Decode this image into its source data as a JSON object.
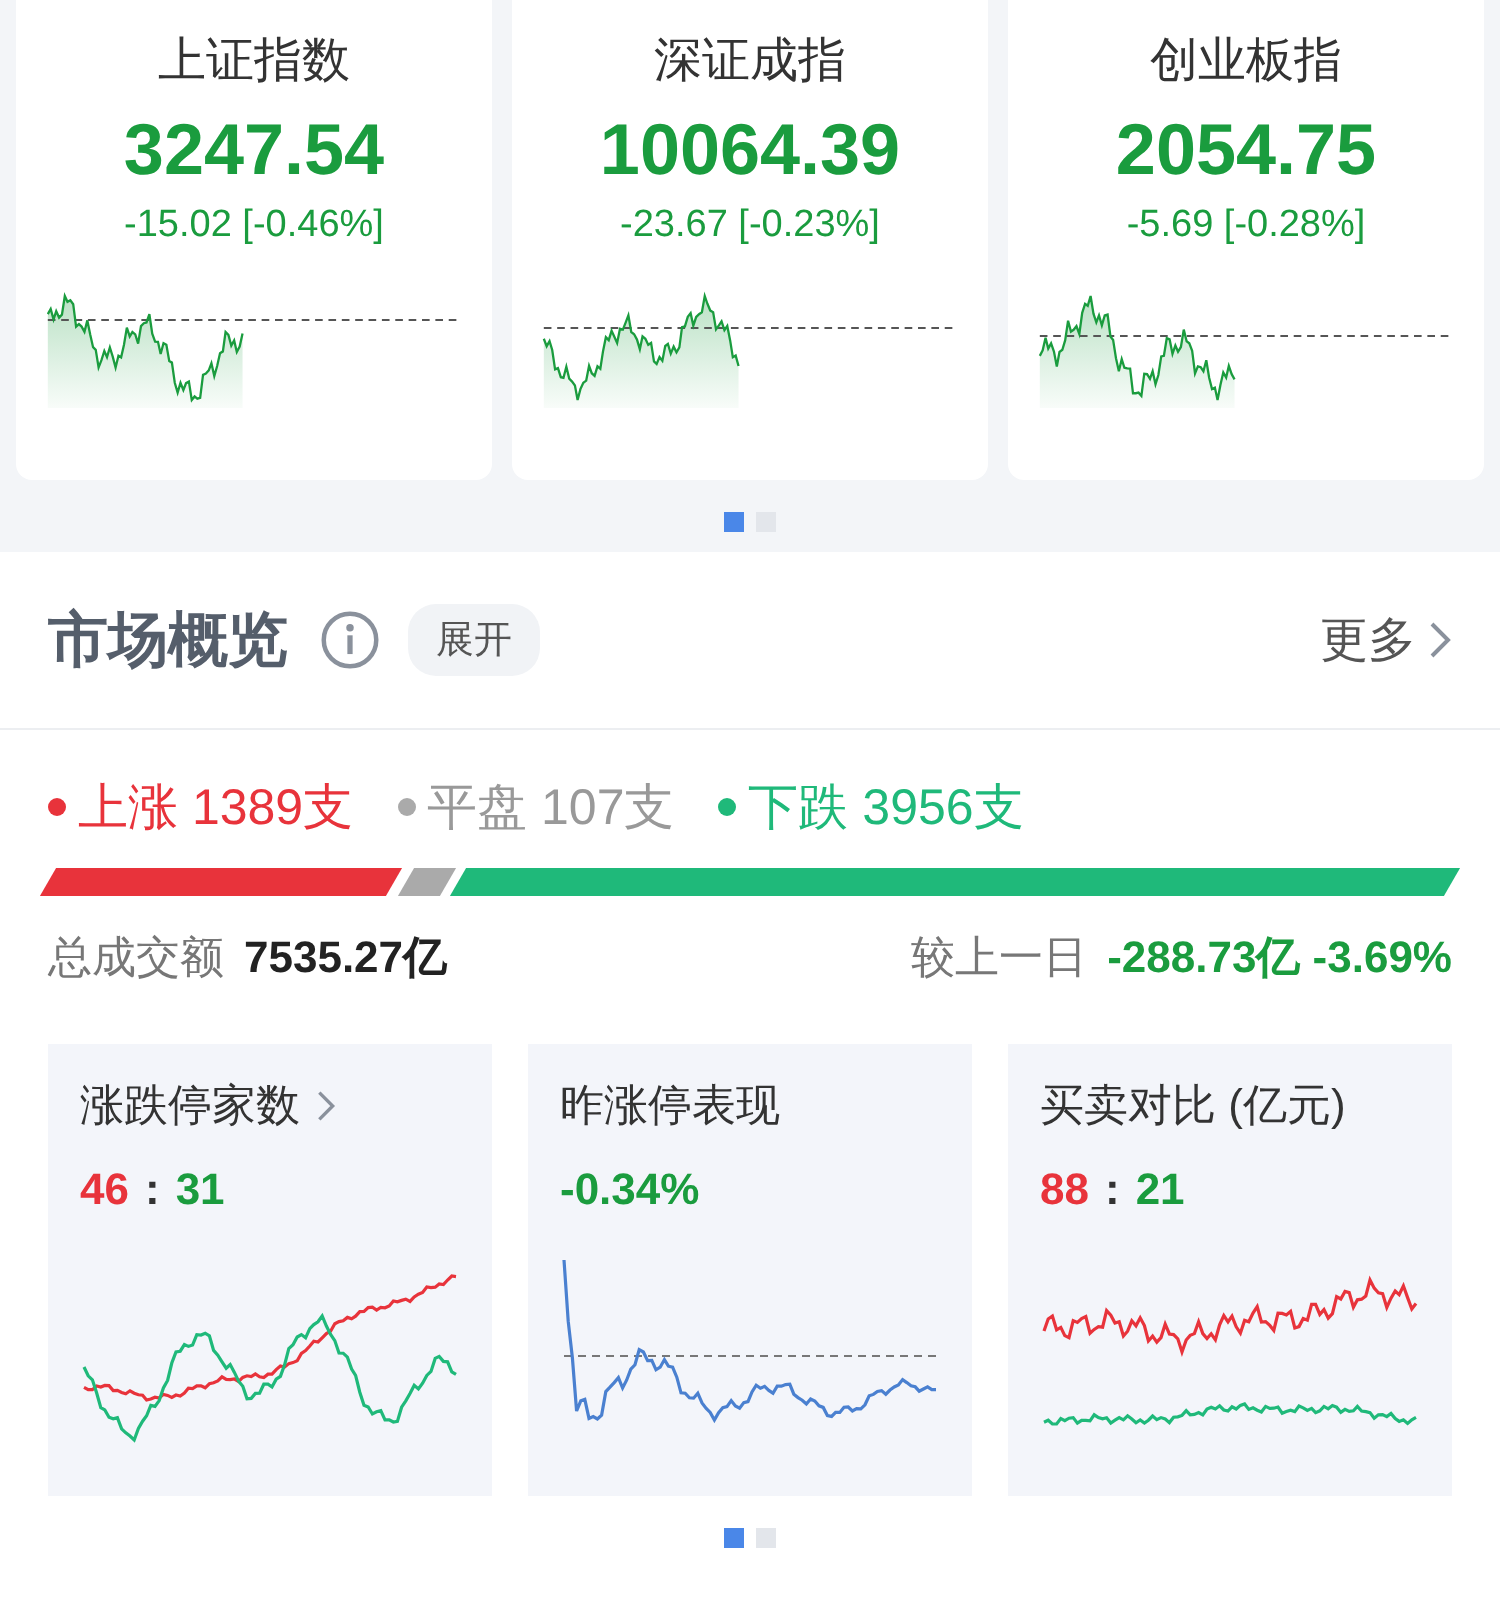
{
  "indices": [
    {
      "title": "上证指数",
      "value": "3247.54",
      "change": "-15.02 [-0.46%]"
    },
    {
      "title": "深证成指",
      "value": "10064.39",
      "change": "-23.67 [-0.23%]"
    },
    {
      "title": "创业板指",
      "value": "2054.75",
      "change": "-5.69 [-0.28%]"
    }
  ],
  "indices_pager": [
    {
      "selected": true
    },
    {
      "selected": false
    }
  ],
  "overview": {
    "title": "市场概览",
    "expand_label": "展开",
    "more_label": "更多",
    "breadth": [
      {
        "kind": "up",
        "label": "上涨 1389支"
      },
      {
        "kind": "flat",
        "label": "平盘 107支"
      },
      {
        "kind": "down",
        "label": "下跌 3956支"
      }
    ],
    "turnover_label": "总成交额",
    "turnover_value": "7535.27亿",
    "compare_label": "较上一日",
    "compare_value": "-288.73亿 -3.69%"
  },
  "panels": [
    {
      "title": "涨跌停家数",
      "chevron": true,
      "kind": "dual",
      "parts": [
        {
          "text": "46",
          "kind": "up"
        },
        {
          "text": ":",
          "kind": "neutral"
        },
        {
          "text": "31",
          "kind": "down"
        }
      ]
    },
    {
      "title": "昨涨停表现",
      "chevron": false,
      "kind": "single",
      "parts": [
        {
          "text": "-0.34%",
          "kind": "down"
        }
      ]
    },
    {
      "title": "买卖对比 (亿元)",
      "chevron": false,
      "kind": "pair",
      "parts": [
        {
          "text": "88",
          "kind": "up"
        },
        {
          "text": ":",
          "kind": "neutral"
        },
        {
          "text": "21",
          "kind": "down"
        }
      ]
    }
  ],
  "panels_pager": [
    {
      "selected": true
    },
    {
      "selected": false
    }
  ]
}
